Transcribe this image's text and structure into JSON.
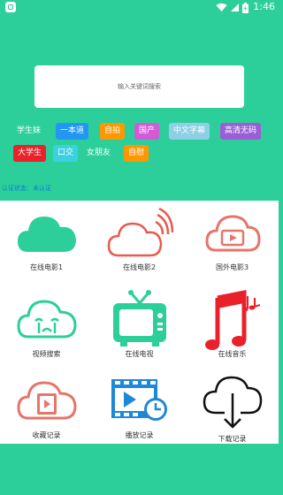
{
  "status": {
    "time": "1:46"
  },
  "search": {
    "placeholder": "输入关键词搜索"
  },
  "tags": [
    {
      "label": "学生妹",
      "bg": ""
    },
    {
      "label": "一本道",
      "bg": "#2196f3"
    },
    {
      "label": "自拍",
      "bg": "#ff9800"
    },
    {
      "label": "国产",
      "bg": "#d45bd6"
    },
    {
      "label": "中文字幕",
      "bg": "#8ecfe6"
    },
    {
      "label": "高清无码",
      "bg": "#9c5ed6"
    },
    {
      "label": "大学生",
      "bg": "#e8212a"
    },
    {
      "label": "口交",
      "bg": "#3ad0e0"
    },
    {
      "label": "女朋友",
      "bg": ""
    },
    {
      "label": "自慰",
      "bg": "#ff9800"
    }
  ],
  "auth_status": "认证状态：未认证",
  "grid": [
    {
      "label": "在线电影1",
      "icon": "cloud-icon"
    },
    {
      "label": "在线电影2",
      "icon": "cloud-signal-icon"
    },
    {
      "label": "国外电影3",
      "icon": "cloud-play-icon"
    },
    {
      "label": "视频搜索",
      "icon": "cloud-crying-icon"
    },
    {
      "label": "在线电视",
      "icon": "tv-icon"
    },
    {
      "label": "在线音乐",
      "icon": "music-notes-icon"
    },
    {
      "label": "收藏记录",
      "icon": "cloud-film-icon"
    },
    {
      "label": "播放记录",
      "icon": "film-clock-icon"
    },
    {
      "label": "下载记录",
      "icon": "cloud-download-icon"
    }
  ]
}
